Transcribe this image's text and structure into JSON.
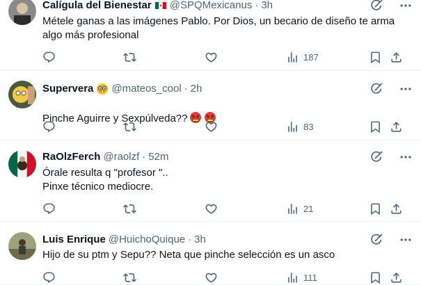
{
  "tweets": [
    {
      "display_name": "Calígula del Bienestar",
      "handle": "@SPQMexicanus",
      "time": "3h",
      "text": "Métele ganas a las imágenes Pablo. Por Dios, un becario de diseño te arma algo más profesional",
      "views": "187",
      "name_emoji": "mexico-flag"
    },
    {
      "display_name": "Supervera",
      "handle": "@mateos_cool",
      "time": "2h",
      "text": "Pinche Aguirre y Sexpúlveda??",
      "views": "83",
      "name_emoji": "nerd-face",
      "text_emojis": [
        "cursing-face",
        "cursing-face"
      ]
    },
    {
      "display_name": "RaOlzFerch",
      "handle": "@raolzf",
      "time": "52m",
      "text": "Órale resulta q \"profesor \"..\nPinxe técnico mediocre.",
      "views": "21"
    },
    {
      "display_name": "Luis Enrique",
      "handle": "@HuichoQuique",
      "time": "3h",
      "text": "Hijo de su ptm y Sepu?? Neta que pinche selección es un asco",
      "views": "111"
    }
  ],
  "colors": {
    "text": "#0f1419",
    "secondary": "#536471",
    "divider": "#eff3f4"
  },
  "icons": [
    "reply-icon",
    "retweet-icon",
    "like-icon",
    "views-icon",
    "bookmark-icon",
    "share-icon",
    "grok-icon",
    "more-icon"
  ]
}
